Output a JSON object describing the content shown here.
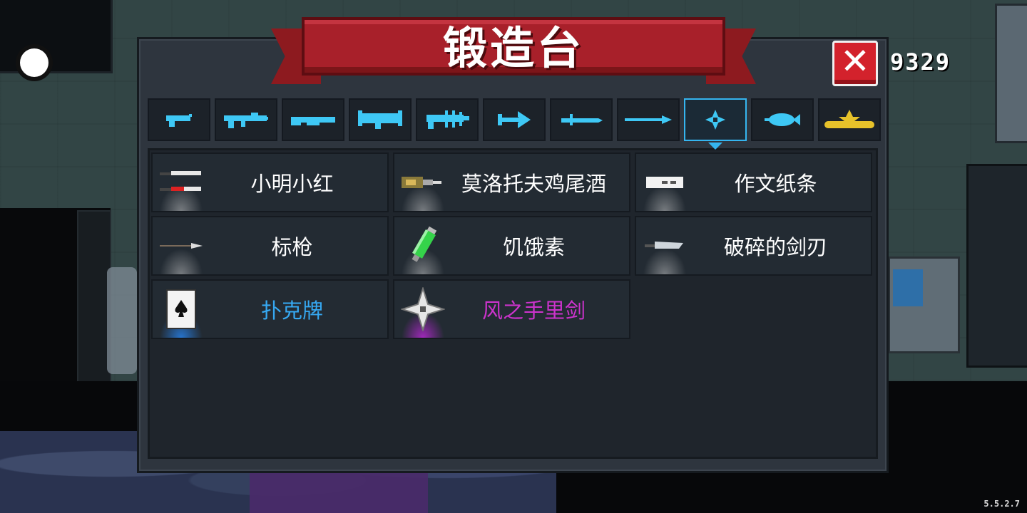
{
  "hud": {
    "score": "9329",
    "version": "5.5.2.7"
  },
  "forge": {
    "title": "锻造台",
    "close_label": "✕",
    "tabs": [
      {
        "icon": "pistol-icon",
        "active": false
      },
      {
        "icon": "assault-rifle-icon",
        "active": false
      },
      {
        "icon": "shotgun-icon",
        "active": false
      },
      {
        "icon": "rocket-launcher-icon",
        "active": false
      },
      {
        "icon": "laser-gun-icon",
        "active": false
      },
      {
        "icon": "bow-icon",
        "active": false
      },
      {
        "icon": "sword-icon",
        "active": false
      },
      {
        "icon": "spear-icon",
        "active": false
      },
      {
        "icon": "throwing-weapon-icon",
        "active": true
      },
      {
        "icon": "fish-icon",
        "active": false
      },
      {
        "icon": "crown-icon",
        "active": false
      }
    ],
    "items": [
      {
        "name": "小明小红",
        "icon": "twin-knives-icon",
        "rarity": "white"
      },
      {
        "name": "莫洛托夫鸡尾酒",
        "icon": "molotov-icon",
        "rarity": "white"
      },
      {
        "name": "作文纸条",
        "icon": "paper-note-icon",
        "rarity": "white"
      },
      {
        "name": "标枪",
        "icon": "javelin-icon",
        "rarity": "white"
      },
      {
        "name": "饥饿素",
        "icon": "syringe-icon",
        "rarity": "white"
      },
      {
        "name": "破碎的剑刃",
        "icon": "broken-blade-icon",
        "rarity": "white"
      },
      {
        "name": "扑克牌",
        "icon": "poker-card-icon",
        "rarity": "blue"
      },
      {
        "name": "风之手里剑",
        "icon": "wind-shuriken-icon",
        "rarity": "purple"
      }
    ]
  },
  "colors": {
    "banner_red": "#a8202a",
    "tab_icon_blue": "#3ec8f5",
    "active_tab_border": "#35b5ef",
    "rarity_blue": "#36a9f3",
    "rarity_purple": "#cc33cc"
  }
}
